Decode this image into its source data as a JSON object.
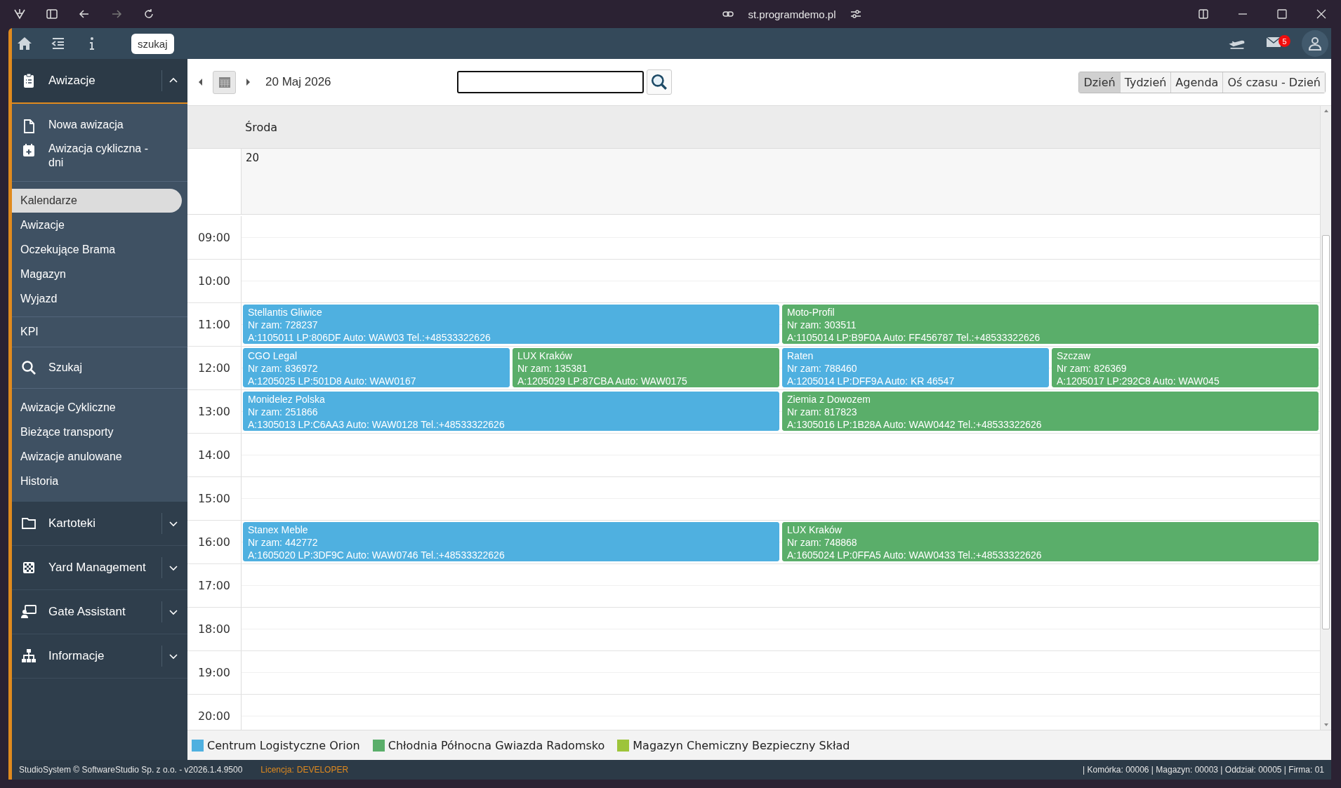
{
  "browser": {
    "url": "st.programdemo.pl"
  },
  "topbar": {
    "tooltip": "szukaj",
    "mail_count": "5"
  },
  "sidebar": {
    "header": {
      "title": "Awizacje",
      "expanded": true
    },
    "actions": [
      {
        "label": "Nowa awizacja"
      },
      {
        "label": "Awizacja cykliczna - dni"
      }
    ],
    "links": [
      {
        "label": "Kalendarze",
        "selected": true
      },
      {
        "label": "Awizacje",
        "selected": false
      },
      {
        "label": "Oczekujące Brama",
        "selected": false
      },
      {
        "label": "Magazyn",
        "selected": false
      },
      {
        "label": "Wyjazd",
        "selected": false
      }
    ],
    "kpi": "KPI",
    "search_label": "Szukaj",
    "links2": [
      {
        "label": "Awizacje Cykliczne",
        "selected": false
      },
      {
        "label": "Bieżące transporty",
        "selected": false
      },
      {
        "label": "Awizacje anulowane",
        "selected": false
      },
      {
        "label": "Historia",
        "selected": false
      }
    ],
    "groups": [
      {
        "label": "Kartoteki",
        "expanded": false
      },
      {
        "label": "Yard Management",
        "expanded": false
      },
      {
        "label": "Gate Assistant",
        "expanded": false
      },
      {
        "label": "Informacje",
        "expanded": false
      }
    ]
  },
  "toolbar": {
    "date": "20 Maj 2026",
    "views": [
      {
        "label": "Dzień",
        "selected": true
      },
      {
        "label": "Tydzień",
        "selected": false
      },
      {
        "label": "Agenda",
        "selected": false
      },
      {
        "label": "Oś czasu - Dzień",
        "selected": false
      }
    ]
  },
  "calendar": {
    "day_name": "Środa",
    "day_number": "20",
    "hours": [
      {
        "label": "09:00"
      },
      {
        "label": "10:00"
      },
      {
        "label": "11:00",
        "events": [
          {
            "title": "Stellantis Gliwice",
            "order": "Nr zam: 728237",
            "details": "A:1105011 LP:806DF Auto: WAW03 Tel.:+48533322626",
            "color": "#4fb0e0"
          },
          {
            "title": "Moto-Profil",
            "order": "Nr zam: 303511",
            "details": "A:1105014 LP:B9F0A Auto: FF456787 Tel.:+48533322626",
            "color": "#5aae6a"
          }
        ]
      },
      {
        "label": "12:00",
        "events": [
          {
            "title": "CGO Legal",
            "order": "Nr zam: 836972",
            "details": "A:1205025 LP:501D8 Auto: WAW0167",
            "color": "#4fb0e0"
          },
          {
            "title": "LUX Kraków",
            "order": "Nr zam: 135381",
            "details": "A:1205029 LP:87CBA Auto: WAW0175",
            "color": "#5aae6a"
          },
          {
            "title": "Raten",
            "order": "Nr zam: 788460",
            "details": "A:1205014 LP:DFF9A Auto: KR 46547",
            "color": "#4fb0e0"
          },
          {
            "title": "Szczaw",
            "order": "Nr zam: 826369",
            "details": "A:1205017 LP:292C8 Auto: WAW045",
            "color": "#5aae6a"
          }
        ]
      },
      {
        "label": "13:00",
        "events": [
          {
            "title": "Monidelez Polska",
            "order": "Nr zam: 251866",
            "details": "A:1305013 LP:C6AA3 Auto: WAW0128 Tel.:+48533322626",
            "color": "#4fb0e0"
          },
          {
            "title": "Ziemia z Dowozem",
            "order": "Nr zam: 817823",
            "details": "A:1305016 LP:1B28A Auto: WAW0442 Tel.:+48533322626",
            "color": "#5aae6a"
          }
        ]
      },
      {
        "label": "14:00"
      },
      {
        "label": "15:00"
      },
      {
        "label": "16:00",
        "events": [
          {
            "title": "Stanex Meble",
            "order": "Nr zam: 442772",
            "details": "A:1605020 LP:3DF9C Auto: WAW0746 Tel.:+48533322626",
            "color": "#4fb0e0"
          },
          {
            "title": "LUX Kraków",
            "order": "Nr zam: 748868",
            "details": "A:1605024 LP:0FFA5 Auto: WAW0433 Tel.:+48533322626",
            "color": "#5aae6a"
          }
        ]
      },
      {
        "label": "17:00"
      },
      {
        "label": "18:00"
      },
      {
        "label": "19:00"
      },
      {
        "label": "20:00"
      }
    ]
  },
  "legend": [
    {
      "label": "Centrum Logistyczne Orion",
      "color": "#4fb0e0"
    },
    {
      "label": "Chłodnia Północna Gwiazda Radomsko",
      "color": "#5aae6a"
    },
    {
      "label": "Magazyn Chemiczny Bezpieczny Skład",
      "color": "#9dc43a"
    }
  ],
  "footer": {
    "copyright": "StudioSystem © SoftwareStudio Sp. z o.o. - v2026.1.4.9500",
    "license_label": "Licencja:",
    "license_value": "DEVELOPER",
    "context": "| Komórka: 00006 | Magazyn: 00003 | Oddział: 00005 | Firma: 01"
  }
}
